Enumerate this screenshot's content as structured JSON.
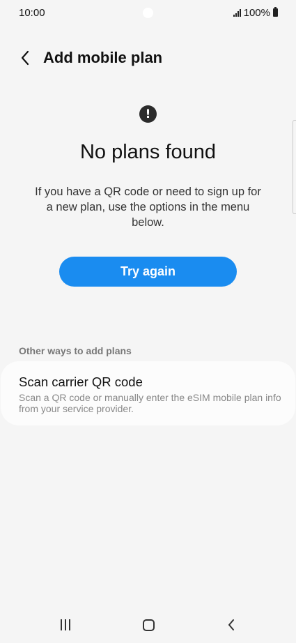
{
  "status_bar": {
    "time": "10:00",
    "battery": "100%"
  },
  "header": {
    "title": "Add mobile plan",
    "back_icon": "chevron-left-icon"
  },
  "empty_state": {
    "icon": "exclamation-circle-icon",
    "icon_glyph": "!",
    "title": "No plans found",
    "description": "If you have a QR code or need to sign up for a new plan, use the options in the menu below.",
    "button_label": "Try again"
  },
  "other_ways": {
    "section_header": "Other ways to add plans",
    "items": [
      {
        "title": "Scan carrier QR code",
        "description": "Scan a QR code or manually enter the eSIM mobile plan info from your service provider."
      }
    ]
  },
  "colors": {
    "accent": "#1a8cf0",
    "background": "#f5f5f5",
    "card": "#fcfcfc"
  }
}
